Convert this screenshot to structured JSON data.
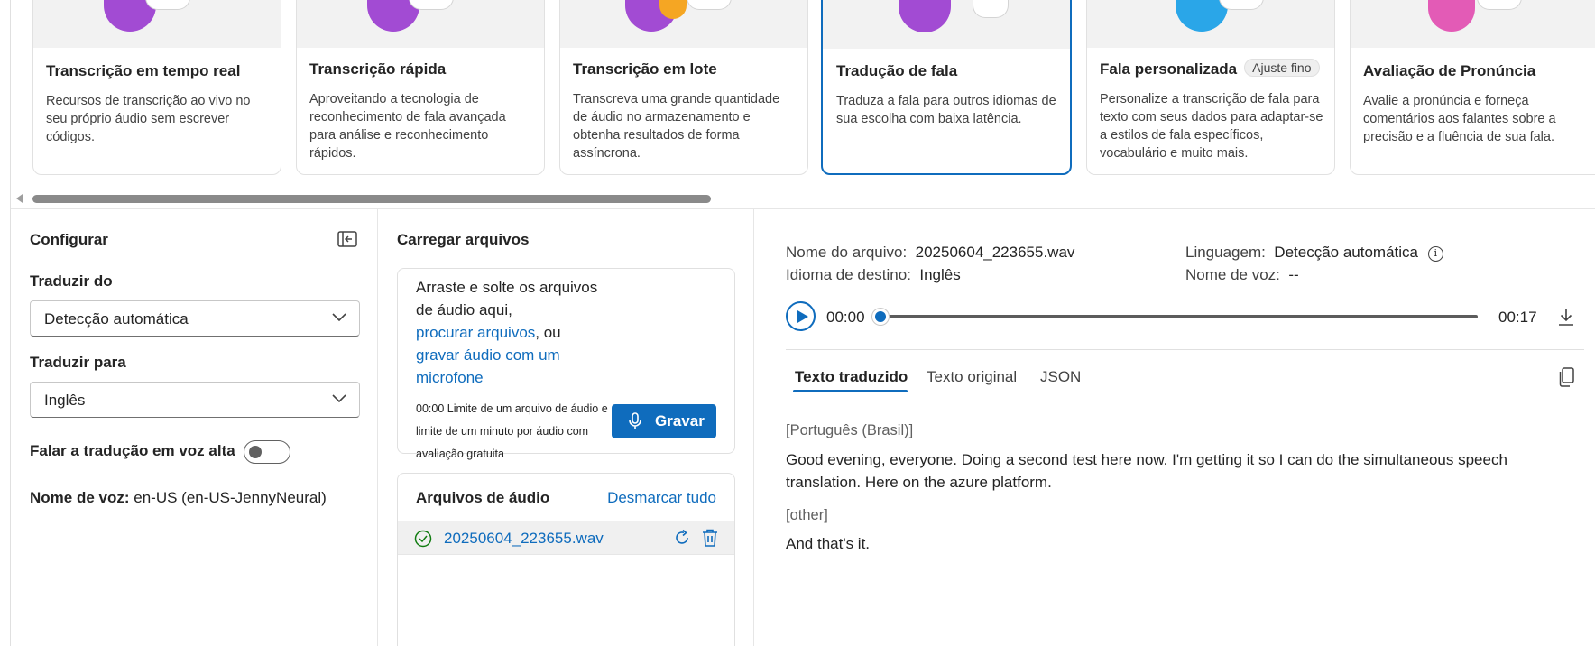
{
  "colors": {
    "accent": "#0f6cbd",
    "card_thumb_bg": "#f2f2f2"
  },
  "cards": [
    {
      "title": "Transcrição em tempo real",
      "desc": "Recursos de transcrição ao vivo no seu próprio áudio sem escrever códigos.",
      "art_color": "#a24bd3",
      "badge": ""
    },
    {
      "title": "Transcrição rápida",
      "desc": "Aproveitando a tecnologia de reconhecimento de fala avançada para análise e reconhecimento rápidos.",
      "art_color": "#a24bd3",
      "badge": ""
    },
    {
      "title": "Transcrição em lote",
      "desc": "Transcreva uma grande quantidade de áudio no armazenamento e obtenha resultados de forma assíncrona.",
      "art_color": "#a24bd3",
      "badge": ""
    },
    {
      "title": "Tradução de fala",
      "desc": "Traduza a fala para outros idiomas de sua escolha com baixa latência.",
      "art_color": "#a24bd3",
      "badge": ""
    },
    {
      "title": "Fala personalizada",
      "desc": "Personalize a transcrição de fala para texto com seus dados para adaptar-se a estilos de fala específicos, vocabulário e muito mais.",
      "art_color": "#2aa6e8",
      "badge": "Ajuste fino"
    },
    {
      "title": "Avaliação de Pronúncia",
      "desc": "Avalie a pronúncia e forneça comentários aos falantes sobre a precisão e a fluência de sua fala.",
      "art_color": "#e35bb6",
      "badge": ""
    }
  ],
  "config": {
    "title": "Configurar",
    "translate_from_label": "Traduzir do",
    "translate_from_value": "Detecção automática",
    "translate_to_label": "Traduzir para",
    "translate_to_value": "Inglês",
    "speak_label": "Falar a tradução em voz alta",
    "speak_enabled": false,
    "voice_label": "Nome de voz:",
    "voice_value": "en-US (en-US-JennyNeural)"
  },
  "upload": {
    "title": "Carregar arquivos",
    "drop_text": "Arraste e solte os arquivos de áudio aqui,",
    "browse_link": "procurar arquivos",
    "or_text": ", ou",
    "record_link": "gravar áudio com um microfone",
    "limit_text": "00:00 Limite de um arquivo de áudio e limite de um minuto por áudio com avaliação gratuita",
    "record_button": "Gravar",
    "files_title": "Arquivos de áudio",
    "unselect_all": "Desmarcar tudo",
    "files": [
      {
        "name": "20250604_223655.wav"
      }
    ]
  },
  "result": {
    "file_label": "Nome do arquivo:",
    "file_value": "20250604_223655.wav",
    "lang_label": "Linguagem:",
    "lang_value": "Detecção automática",
    "target_label": "Idioma de destino:",
    "target_value": "Inglês",
    "voice_label": "Nome de voz:",
    "voice_value": "--",
    "time_current": "00:00",
    "time_total": "00:17",
    "progress": 0,
    "tabs": [
      "Texto traduzido",
      "Texto original",
      "JSON"
    ],
    "active_tab": "Texto traduzido",
    "segments": [
      {
        "lang": "[Português (Brasil)]",
        "text": "Good evening, everyone. Doing a second test here now. I'm getting it so I can do the simultaneous speech translation. Here on the azure platform."
      },
      {
        "lang": "[other]",
        "text": "And that's it."
      }
    ]
  }
}
